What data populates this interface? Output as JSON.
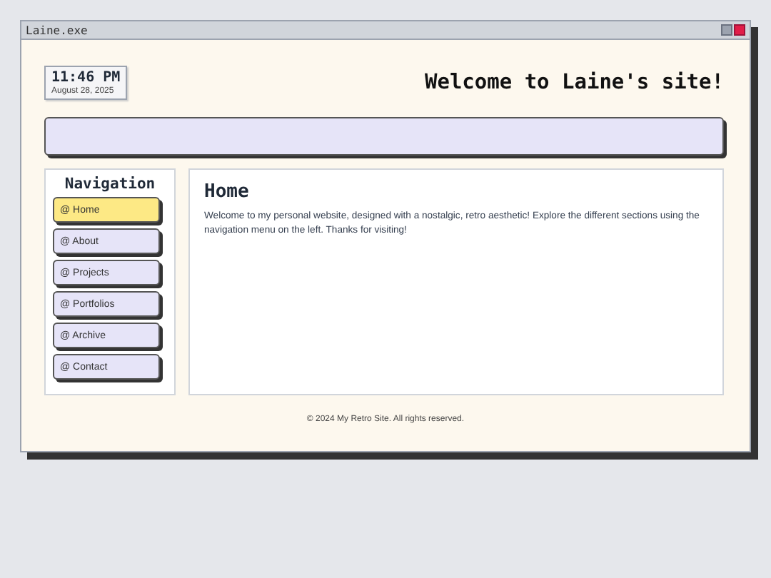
{
  "window": {
    "title": "Laine.exe"
  },
  "clock": {
    "time": "11:46 PM",
    "date": "August 28, 2025"
  },
  "site_title": "Welcome to Laine's site!",
  "navigation": {
    "heading": "Navigation",
    "items": [
      {
        "label": "@ Home",
        "selected": true
      },
      {
        "label": "@ About",
        "selected": false
      },
      {
        "label": "@ Projects",
        "selected": false
      },
      {
        "label": "@ Portfolios",
        "selected": false
      },
      {
        "label": "@ Archive",
        "selected": false
      },
      {
        "label": "@ Contact",
        "selected": false
      }
    ]
  },
  "content": {
    "heading": "Home",
    "text": "Welcome to my personal website, designed with a nostalgic, retro aesthetic! Explore the different sections using the navigation menu on the left. Thanks for visiting!"
  },
  "footer": "© 2024 My Retro Site. All rights reserved."
}
